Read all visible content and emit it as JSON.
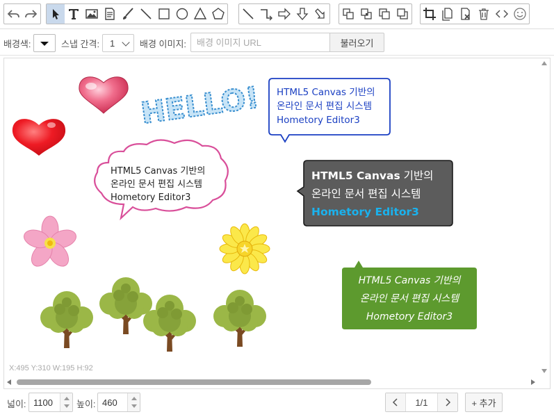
{
  "toolbar": {
    "groups": [
      [
        "undo-icon",
        "redo-icon"
      ],
      [
        "pointer-icon",
        "text-icon",
        "image-icon",
        "document-icon",
        "brush-icon",
        "line-icon",
        "rectangle-icon",
        "circle-icon",
        "triangle-icon",
        "pentagon-icon"
      ],
      [
        "diagonal-line-icon",
        "elbow-connector-icon",
        "arrow-right-icon",
        "arrow-down-icon",
        "arrow-diagonal-icon"
      ],
      [
        "bring-front-icon",
        "send-back-icon",
        "bring-forward-icon",
        "send-backward-icon"
      ],
      [
        "crop-icon",
        "copy-icon",
        "clear-icon",
        "trash-icon",
        "code-icon",
        "smiley-icon"
      ]
    ],
    "active": "pointer-icon"
  },
  "options": {
    "bg_color_label": "배경색:",
    "snap_label": "스냅 간격:",
    "snap_value": "1",
    "bg_image_label": "배경 이미지:",
    "bg_image_placeholder": "배경 이미지 URL",
    "load_button": "불러오기"
  },
  "canvas": {
    "coords_readout": "X:495 Y:310 W:195 H:92",
    "hello_text": "HELLO!",
    "bubbles": [
      {
        "line1": "HTML5 Canvas 기반의",
        "line2": "온라인 문서 편집 시스템",
        "line3": "Hometory Editor3"
      },
      {
        "line1": "HTML5 Canvas 기반의",
        "line2": "온라인 문서 편집 시스템",
        "line3": "Hometory Editor3"
      },
      {
        "line1_bold": "HTML5 Canvas",
        "line1_rest": " 기반의",
        "line2": "온라인 문서 편집 시스템",
        "line3": "Hometory Editor3"
      },
      {
        "line1": "HTML5 Canvas 기반의",
        "line2": "온라인 문서 편집 시스템",
        "line3": "Hometory Editor3"
      }
    ],
    "colors": {
      "blue_bubble": "#1a3fc2",
      "pink_bubble": "#d94f9a",
      "dark_bubble": "#5c5c5c",
      "dark_bubble_accent": "#1ab2ee",
      "green_bubble": "#5d9a2e"
    }
  },
  "bottom": {
    "width_label": "넓이:",
    "width_value": "1100",
    "height_label": "높이:",
    "height_value": "460",
    "page_indicator": "1/1",
    "add_button": "+ 추가"
  }
}
